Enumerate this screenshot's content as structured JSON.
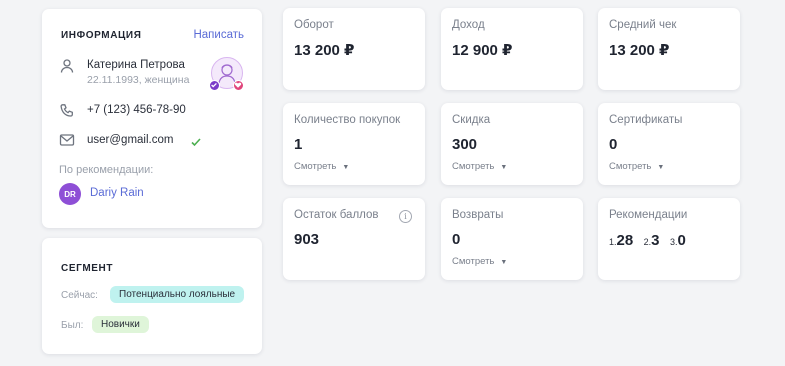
{
  "info": {
    "title": "ИНФОРМАЦИЯ",
    "write_link": "Написать",
    "name": "Катерина Петрова",
    "birth_gender": "22.11.1993, женщина",
    "phone": "+7 (123) 456-78-90",
    "email": "user@gmail.com",
    "referral_label": "По рекомендации:",
    "referral_initials": "DR",
    "referral_name": "Dariy Rain"
  },
  "segment": {
    "title": "СЕГМЕНТ",
    "now_label": "Сейчас:",
    "now_value": "Потенциально лояльные",
    "was_label": "Был:",
    "was_value": "Новички"
  },
  "stats": {
    "turnover": {
      "label": "Оборот",
      "value": "13 200 ₽"
    },
    "income": {
      "label": "Доход",
      "value": "12 900 ₽"
    },
    "avg_check": {
      "label": "Средний чек",
      "value": "13 200 ₽"
    },
    "purchases": {
      "label": "Количество покупок",
      "value": "1",
      "watch": "Смотреть"
    },
    "discount": {
      "label": "Скидка",
      "value": "300",
      "watch": "Смотреть"
    },
    "certificates": {
      "label": "Сертификаты",
      "value": "0",
      "watch": "Смотреть"
    },
    "points": {
      "label": "Остаток баллов",
      "value": "903"
    },
    "returns": {
      "label": "Возвраты",
      "value": "0",
      "watch": "Смотреть"
    },
    "recommendations": {
      "label": "Рекомендации",
      "items": [
        {
          "idx": "1.",
          "val": "28"
        },
        {
          "idx": "2.",
          "val": "3"
        },
        {
          "idx": "3.",
          "val": "0"
        }
      ]
    }
  },
  "icons": {
    "user": "user-icon",
    "phone": "phone-icon",
    "mail": "mail-icon",
    "check": "check-icon",
    "info": "info-icon",
    "caret": "caret-down-icon"
  },
  "colors": {
    "accent": "#5a6bd6",
    "check": "#4caf50",
    "pill_now": "#bff2ef",
    "pill_was": "#dff5d9",
    "referral_avatar": "#8e4fd6"
  }
}
